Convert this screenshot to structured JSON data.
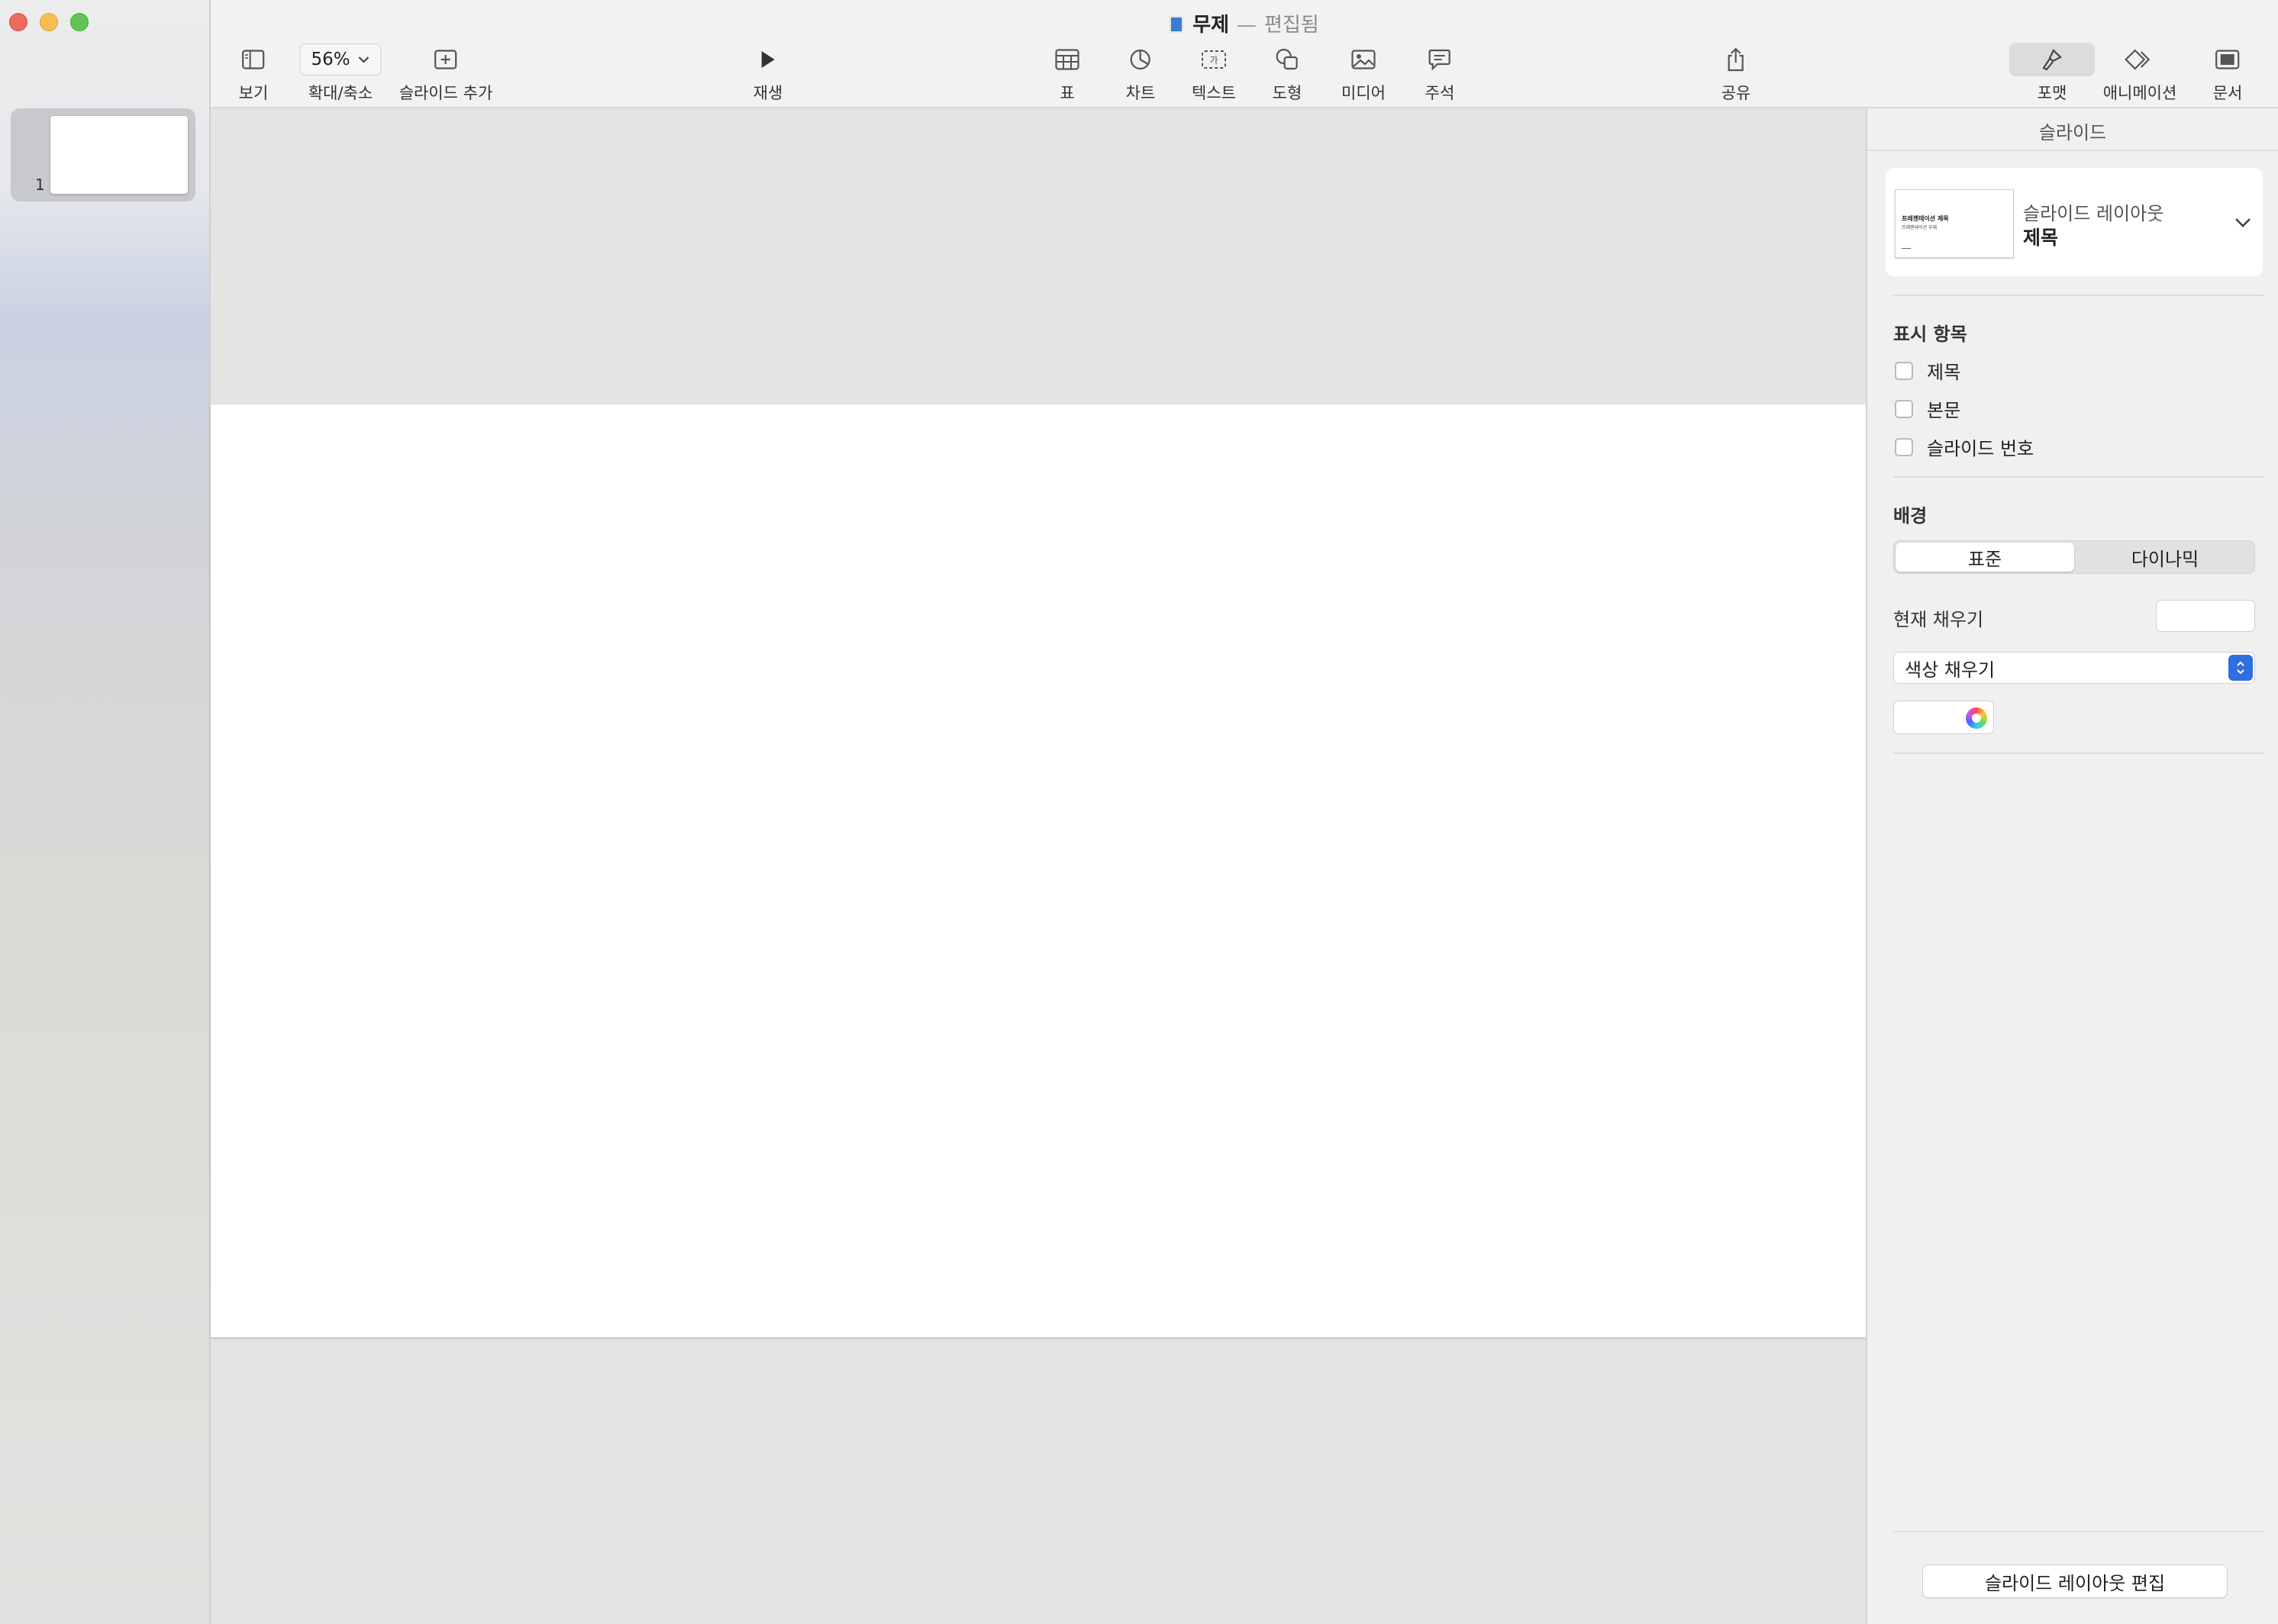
{
  "window": {
    "title": "무제",
    "title_separator": "—",
    "status": "편집됨"
  },
  "toolbar": {
    "view_label": "보기",
    "zoom_value": "56%",
    "zoom_label": "확대/축소",
    "add_slide_label": "슬라이드 추가",
    "play_label": "재생",
    "table_label": "표",
    "chart_label": "차트",
    "text_label": "텍스트",
    "shape_label": "도형",
    "media_label": "미디어",
    "comment_label": "주석",
    "share_label": "공유",
    "format_label": "포맷",
    "animate_label": "애니메이션",
    "document_label": "문서"
  },
  "navigator": {
    "slides": [
      {
        "number": "1"
      }
    ]
  },
  "inspector": {
    "title": "슬라이드",
    "layout": {
      "label": "슬라이드 레이아웃",
      "value": "제목",
      "thumb_title": "프레젠테이션 제목",
      "thumb_subtitle": "프레젠테이션 부제"
    },
    "appearance": {
      "label": "표시 항목",
      "items": [
        {
          "label": "제목",
          "checked": false
        },
        {
          "label": "본문",
          "checked": false
        },
        {
          "label": "슬라이드 번호",
          "checked": false
        }
      ]
    },
    "background": {
      "label": "배경",
      "options": [
        "표준",
        "다이나믹"
      ],
      "selected": "표준",
      "current_fill_label": "현재 채우기",
      "fill_type": "색상 채우기",
      "fill_color": "#ffffff"
    },
    "edit_layout_button": "슬라이드 레이아웃 편집"
  },
  "colors": {
    "accent": "#2f6fe0",
    "close": "#ed6a5e",
    "minimize": "#f5bf4f",
    "maximize": "#61c554"
  }
}
